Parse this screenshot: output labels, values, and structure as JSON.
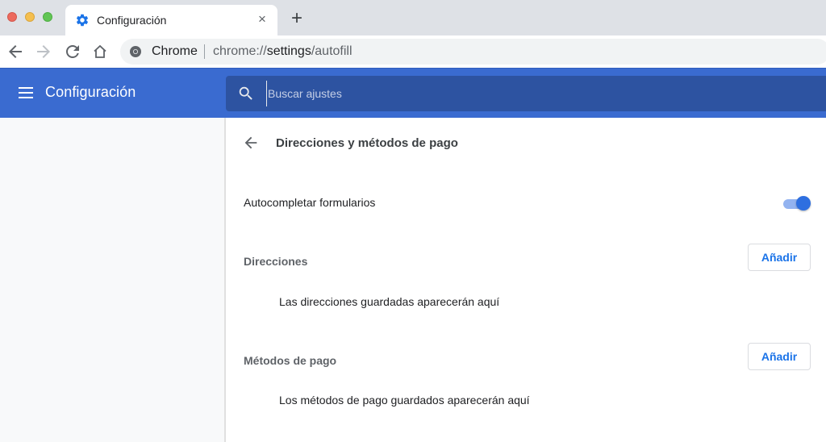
{
  "browser": {
    "tab": {
      "title": "Configuración",
      "icon": "gear-icon",
      "close_glyph": "×"
    },
    "new_tab_glyph": "+",
    "omnibox": {
      "scheme_label": "Chrome",
      "url_prefix": "chrome://",
      "url_host": "settings",
      "url_path": "/autofill"
    }
  },
  "settings": {
    "header_title": "Configuración",
    "search": {
      "placeholder": "Buscar ajustes",
      "value": ""
    },
    "subpage": {
      "title": "Direcciones y métodos de pago",
      "autofill": {
        "label": "Autocompletar formularios",
        "enabled": true
      },
      "sections": [
        {
          "title": "Direcciones",
          "add_label": "Añadir",
          "empty_message": "Las direcciones guardadas aparecerán aquí"
        },
        {
          "title": "Métodos de pago",
          "add_label": "Añadir",
          "empty_message": "Los métodos de pago guardados aparecerán aquí"
        }
      ]
    }
  },
  "colors": {
    "header_blue": "#3a6bd0",
    "search_blue": "#2d53a1",
    "accent": "#1a73e8",
    "toggle_on": "#2e6fe0"
  }
}
